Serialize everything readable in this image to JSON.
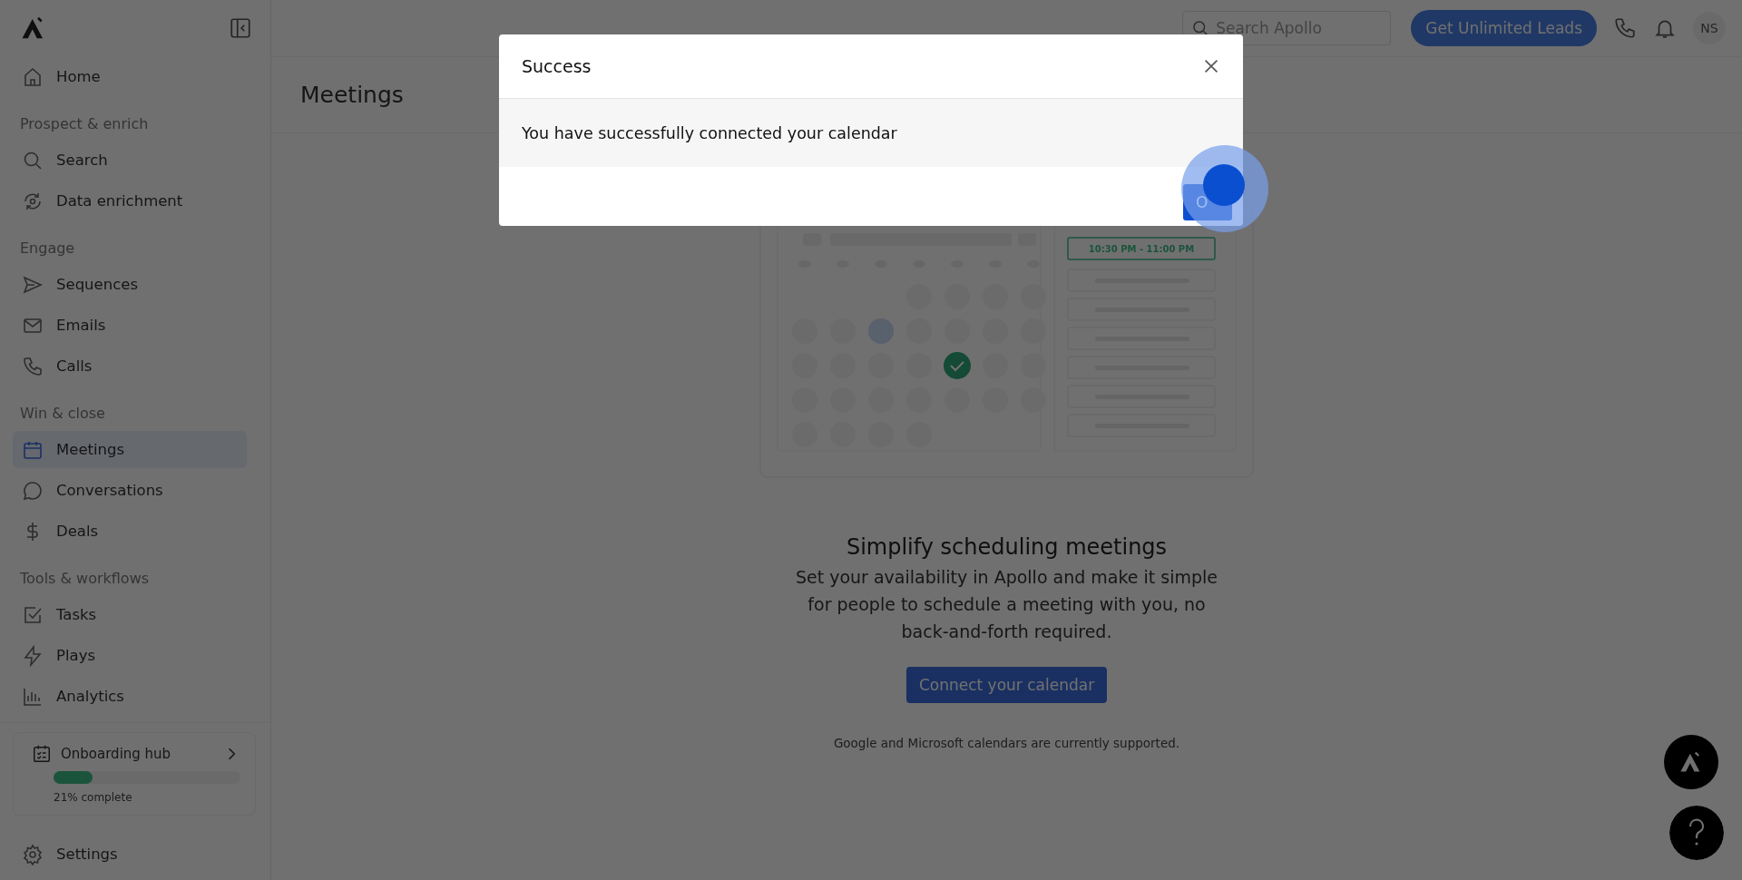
{
  "sidebar": {
    "top_items": [
      {
        "label": "Home",
        "selected": false
      }
    ],
    "sections": [
      {
        "title": "Prospect & enrich",
        "items": [
          {
            "label": "Search",
            "selected": false
          },
          {
            "label": "Data enrichment",
            "selected": false
          }
        ]
      },
      {
        "title": "Engage",
        "items": [
          {
            "label": "Sequences",
            "selected": false
          },
          {
            "label": "Emails",
            "selected": false
          },
          {
            "label": "Calls",
            "selected": false
          }
        ]
      },
      {
        "title": "Win & close",
        "items": [
          {
            "label": "Meetings",
            "selected": true
          },
          {
            "label": "Conversations",
            "selected": false
          },
          {
            "label": "Deals",
            "selected": false
          }
        ]
      },
      {
        "title": "Tools & workflows",
        "items": [
          {
            "label": "Tasks",
            "selected": false
          },
          {
            "label": "Plays",
            "selected": false
          },
          {
            "label": "Analytics",
            "selected": false
          }
        ]
      }
    ],
    "onboarding": {
      "label": "Onboarding hub",
      "level": 0.21,
      "progress_text": "21% complete"
    },
    "bottom_items": [
      {
        "label": "Settings",
        "selected": false
      }
    ]
  },
  "topbar": {
    "search": {
      "placeholder": "Search Apollo"
    },
    "upgrade_button": "Get Unlimited Leads",
    "avatar": "NS"
  },
  "page": {
    "title": "Meetings",
    "illustration": {
      "time_slot": "10:30 PM - 11:00 PM"
    },
    "heading": "Simplify scheduling meetings",
    "text": "Set your availability in Apollo and make it simple for people to schedule a meeting with you, no back-and-forth required.",
    "button": "Connect your calendar",
    "note": "Google and Microsoft calendars are currently supported."
  },
  "modal": {
    "title": "Success",
    "message": "You have successfully connected your calendar",
    "button": "O"
  }
}
